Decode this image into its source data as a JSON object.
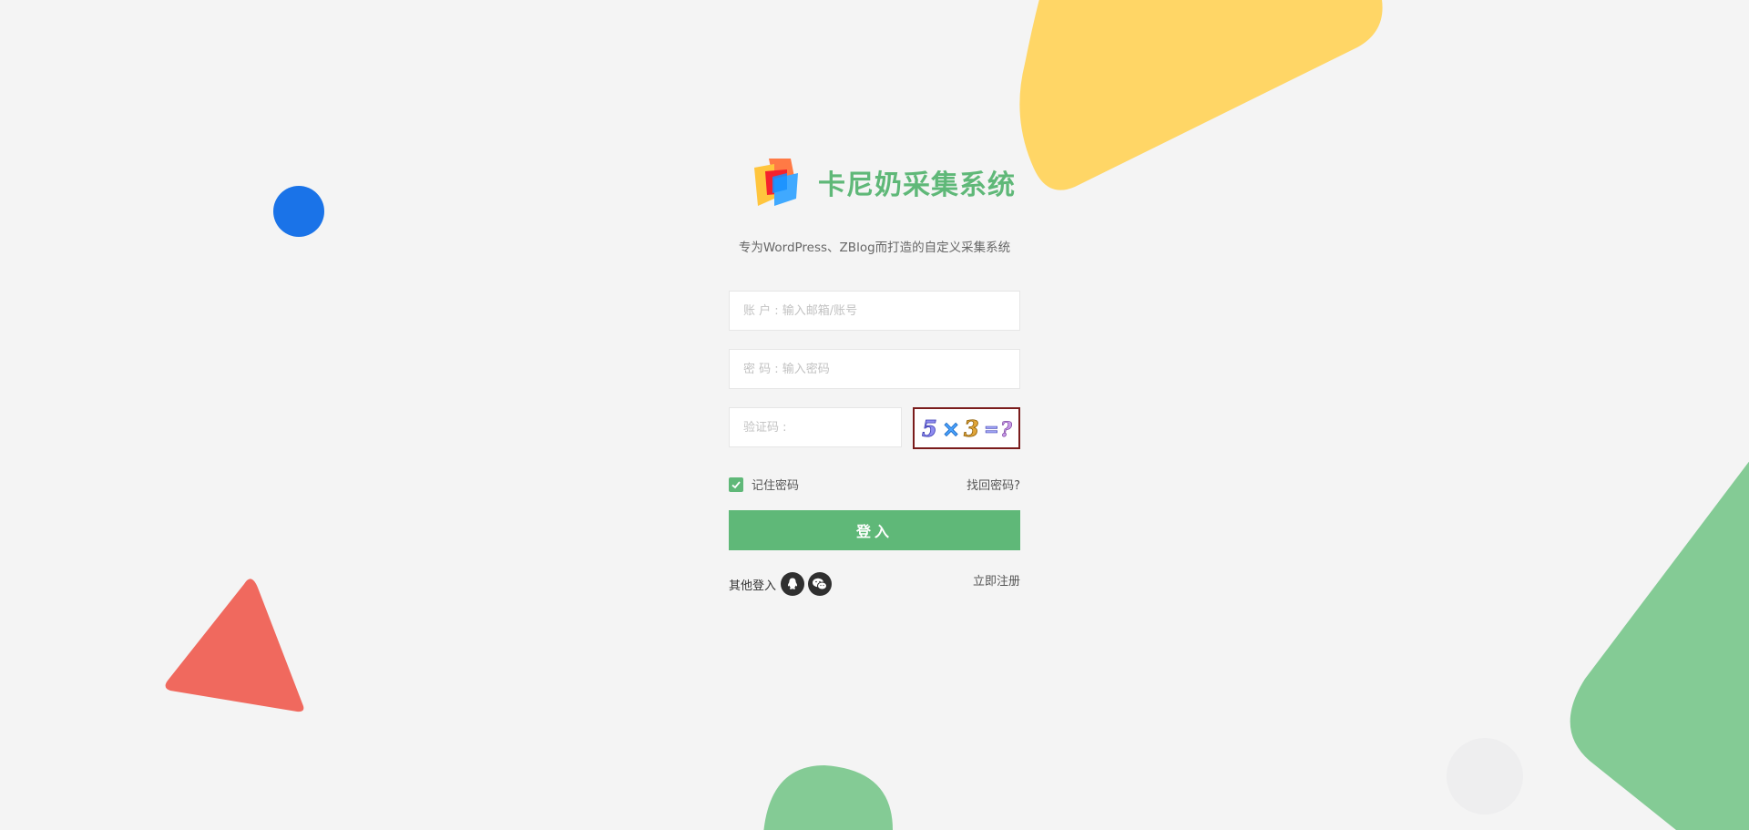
{
  "app": {
    "title": "卡尼奶采集系统",
    "tagline": "专为WordPress、ZBlog而打造的自定义采集系统"
  },
  "form": {
    "username_placeholder": "账 户 : 输入邮箱/账号",
    "password_placeholder": "密 码 : 输入密码",
    "captcha_placeholder": "验证码 :",
    "captcha_text": "5×3=?",
    "remember_label": "记住密码",
    "remember_checked": true,
    "forgot_label": "找回密码?",
    "submit_label": "登入",
    "other_login_label": "其他登入",
    "register_label": "立即注册"
  },
  "social_icons": [
    "qq-icon",
    "wechat-icon"
  ],
  "colors": {
    "accent": "#5fb878",
    "background": "#f4f4f4",
    "yellow_shape": "#ffd666",
    "blue_shape": "#1a73e8",
    "red_shape": "#f0695e",
    "green_shape": "#84cb95",
    "captcha_border": "#7a1c1c"
  }
}
